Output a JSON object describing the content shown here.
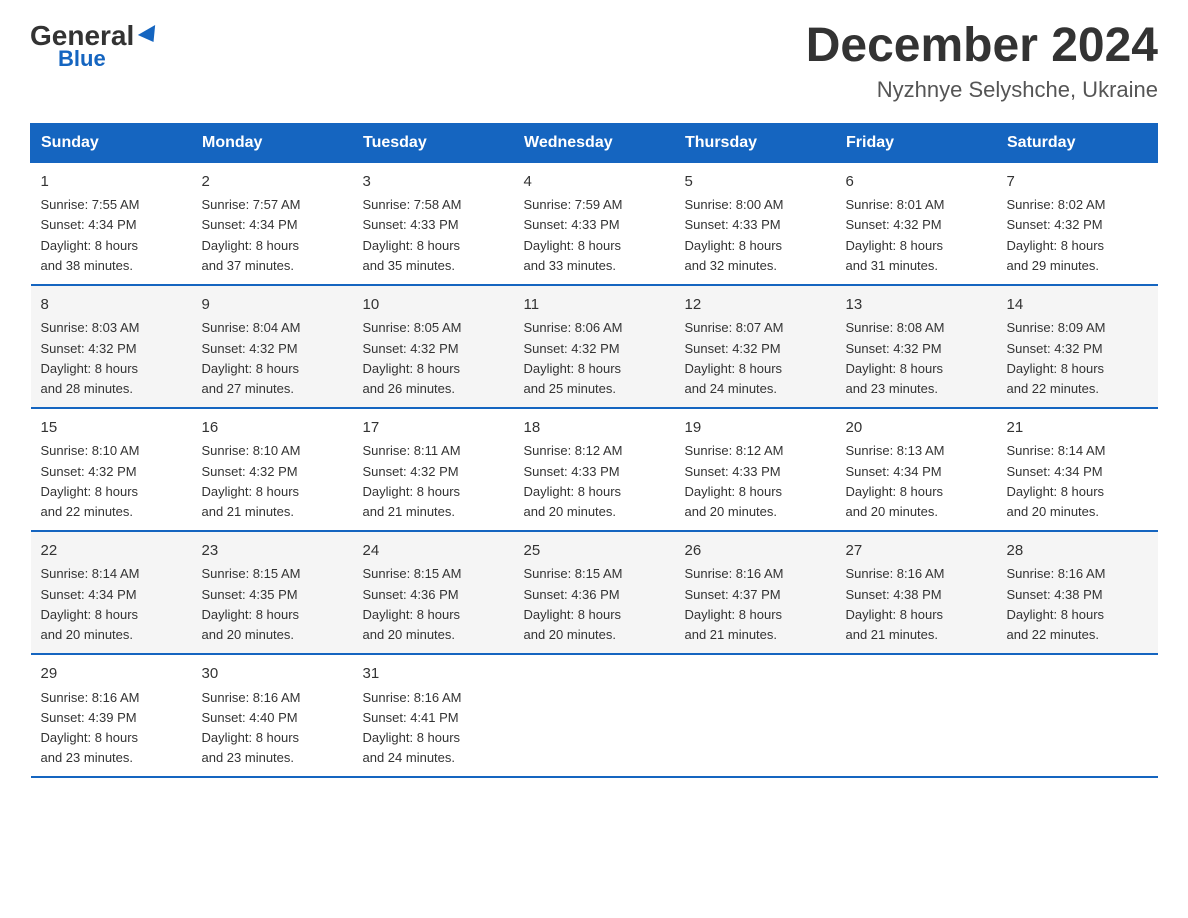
{
  "header": {
    "logo": {
      "general": "General",
      "blue": "Blue"
    },
    "title": "December 2024",
    "location": "Nyzhnye Selyshche, Ukraine"
  },
  "days_of_week": [
    "Sunday",
    "Monday",
    "Tuesday",
    "Wednesday",
    "Thursday",
    "Friday",
    "Saturday"
  ],
  "weeks": [
    [
      {
        "day": "1",
        "sunrise": "7:55 AM",
        "sunset": "4:34 PM",
        "daylight": "8 hours and 38 minutes."
      },
      {
        "day": "2",
        "sunrise": "7:57 AM",
        "sunset": "4:34 PM",
        "daylight": "8 hours and 37 minutes."
      },
      {
        "day": "3",
        "sunrise": "7:58 AM",
        "sunset": "4:33 PM",
        "daylight": "8 hours and 35 minutes."
      },
      {
        "day": "4",
        "sunrise": "7:59 AM",
        "sunset": "4:33 PM",
        "daylight": "8 hours and 33 minutes."
      },
      {
        "day": "5",
        "sunrise": "8:00 AM",
        "sunset": "4:33 PM",
        "daylight": "8 hours and 32 minutes."
      },
      {
        "day": "6",
        "sunrise": "8:01 AM",
        "sunset": "4:32 PM",
        "daylight": "8 hours and 31 minutes."
      },
      {
        "day": "7",
        "sunrise": "8:02 AM",
        "sunset": "4:32 PM",
        "daylight": "8 hours and 29 minutes."
      }
    ],
    [
      {
        "day": "8",
        "sunrise": "8:03 AM",
        "sunset": "4:32 PM",
        "daylight": "8 hours and 28 minutes."
      },
      {
        "day": "9",
        "sunrise": "8:04 AM",
        "sunset": "4:32 PM",
        "daylight": "8 hours and 27 minutes."
      },
      {
        "day": "10",
        "sunrise": "8:05 AM",
        "sunset": "4:32 PM",
        "daylight": "8 hours and 26 minutes."
      },
      {
        "day": "11",
        "sunrise": "8:06 AM",
        "sunset": "4:32 PM",
        "daylight": "8 hours and 25 minutes."
      },
      {
        "day": "12",
        "sunrise": "8:07 AM",
        "sunset": "4:32 PM",
        "daylight": "8 hours and 24 minutes."
      },
      {
        "day": "13",
        "sunrise": "8:08 AM",
        "sunset": "4:32 PM",
        "daylight": "8 hours and 23 minutes."
      },
      {
        "day": "14",
        "sunrise": "8:09 AM",
        "sunset": "4:32 PM",
        "daylight": "8 hours and 22 minutes."
      }
    ],
    [
      {
        "day": "15",
        "sunrise": "8:10 AM",
        "sunset": "4:32 PM",
        "daylight": "8 hours and 22 minutes."
      },
      {
        "day": "16",
        "sunrise": "8:10 AM",
        "sunset": "4:32 PM",
        "daylight": "8 hours and 21 minutes."
      },
      {
        "day": "17",
        "sunrise": "8:11 AM",
        "sunset": "4:32 PM",
        "daylight": "8 hours and 21 minutes."
      },
      {
        "day": "18",
        "sunrise": "8:12 AM",
        "sunset": "4:33 PM",
        "daylight": "8 hours and 20 minutes."
      },
      {
        "day": "19",
        "sunrise": "8:12 AM",
        "sunset": "4:33 PM",
        "daylight": "8 hours and 20 minutes."
      },
      {
        "day": "20",
        "sunrise": "8:13 AM",
        "sunset": "4:34 PM",
        "daylight": "8 hours and 20 minutes."
      },
      {
        "day": "21",
        "sunrise": "8:14 AM",
        "sunset": "4:34 PM",
        "daylight": "8 hours and 20 minutes."
      }
    ],
    [
      {
        "day": "22",
        "sunrise": "8:14 AM",
        "sunset": "4:34 PM",
        "daylight": "8 hours and 20 minutes."
      },
      {
        "day": "23",
        "sunrise": "8:15 AM",
        "sunset": "4:35 PM",
        "daylight": "8 hours and 20 minutes."
      },
      {
        "day": "24",
        "sunrise": "8:15 AM",
        "sunset": "4:36 PM",
        "daylight": "8 hours and 20 minutes."
      },
      {
        "day": "25",
        "sunrise": "8:15 AM",
        "sunset": "4:36 PM",
        "daylight": "8 hours and 20 minutes."
      },
      {
        "day": "26",
        "sunrise": "8:16 AM",
        "sunset": "4:37 PM",
        "daylight": "8 hours and 21 minutes."
      },
      {
        "day": "27",
        "sunrise": "8:16 AM",
        "sunset": "4:38 PM",
        "daylight": "8 hours and 21 minutes."
      },
      {
        "day": "28",
        "sunrise": "8:16 AM",
        "sunset": "4:38 PM",
        "daylight": "8 hours and 22 minutes."
      }
    ],
    [
      {
        "day": "29",
        "sunrise": "8:16 AM",
        "sunset": "4:39 PM",
        "daylight": "8 hours and 23 minutes."
      },
      {
        "day": "30",
        "sunrise": "8:16 AM",
        "sunset": "4:40 PM",
        "daylight": "8 hours and 23 minutes."
      },
      {
        "day": "31",
        "sunrise": "8:16 AM",
        "sunset": "4:41 PM",
        "daylight": "8 hours and 24 minutes."
      },
      null,
      null,
      null,
      null
    ]
  ],
  "labels": {
    "sunrise": "Sunrise:",
    "sunset": "Sunset:",
    "daylight": "Daylight:"
  }
}
